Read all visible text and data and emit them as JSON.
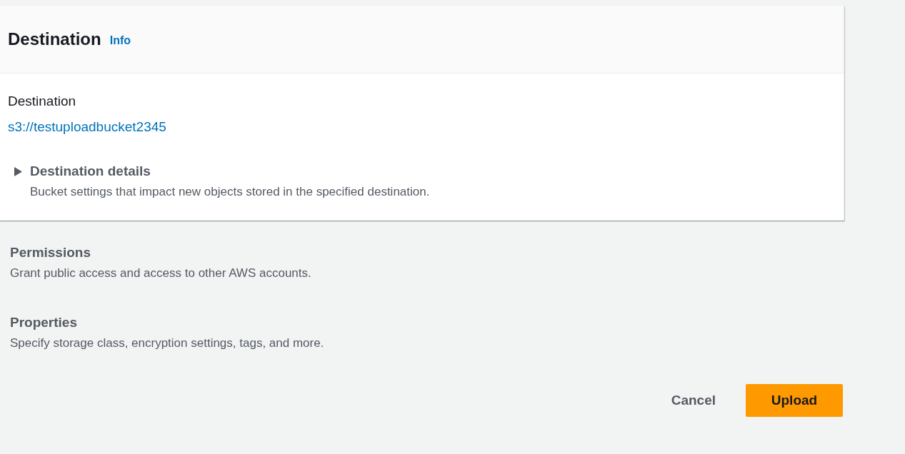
{
  "container": {
    "title": "Destination",
    "info_link": "Info",
    "field_label": "Destination",
    "field_value": "s3://testuploadbucket2345",
    "details": {
      "title": "Destination details",
      "description": "Bucket settings that impact new objects stored in the specified destination.",
      "expanded": false
    }
  },
  "sections": [
    {
      "title": "Permissions",
      "description": "Grant public access and access to other AWS accounts."
    },
    {
      "title": "Properties",
      "description": "Specify storage class, encryption settings, tags, and more."
    }
  ],
  "actions": [
    {
      "label": "Cancel",
      "kind": "link"
    },
    {
      "label": "Upload",
      "kind": "primary"
    }
  ]
}
